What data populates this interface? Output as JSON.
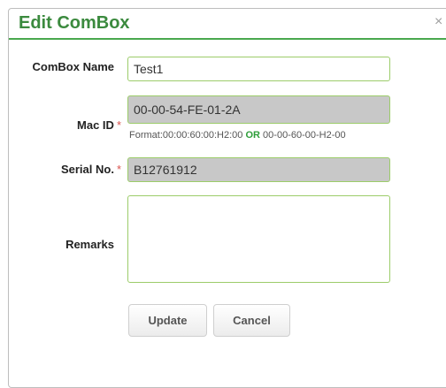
{
  "dialog": {
    "title": "Edit ComBox",
    "close_symbol": "×"
  },
  "form": {
    "combox_name": {
      "label": "ComBox Name",
      "value": "Test1"
    },
    "mac_id": {
      "label": "Mac ID",
      "required_marker": "*",
      "value": "00-00-54-FE-01-2A",
      "hint_prefix": "Format:00:00:60:00:H2:00",
      "hint_or": "OR",
      "hint_suffix": "00-00-60-00-H2-00"
    },
    "serial_no": {
      "label": "Serial No.",
      "required_marker": "*",
      "value": "B12761912"
    },
    "remarks": {
      "label": "Remarks",
      "value": ""
    }
  },
  "buttons": {
    "update": "Update",
    "cancel": "Cancel"
  },
  "colors": {
    "title": "#3b8a3e",
    "header_rule": "#4aa84f",
    "input_border": "#9ccc6a",
    "readonly_bg": "#c8c8c8",
    "required": "#d9534f",
    "or_text": "#2e9e3a"
  }
}
